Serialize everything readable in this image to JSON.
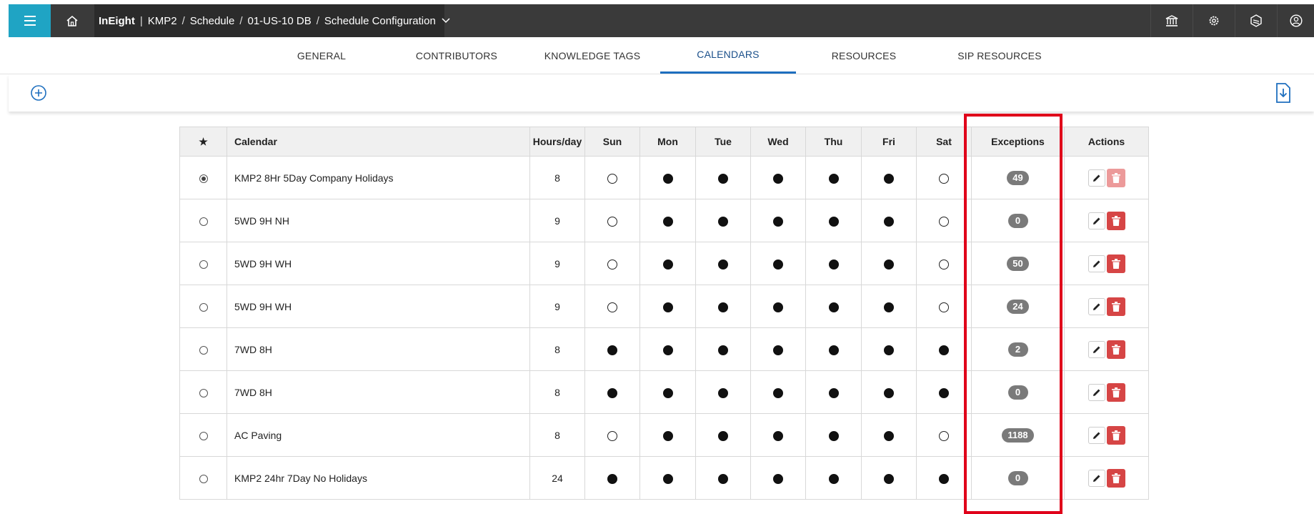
{
  "breadcrumb": {
    "brand": "InEight",
    "divider": "|",
    "items": [
      "KMP2",
      "Schedule",
      "01-US-10 DB",
      "Schedule Configuration"
    ],
    "separator": "/"
  },
  "tabs": [
    {
      "label": "GENERAL",
      "active": false
    },
    {
      "label": "CONTRIBUTORS",
      "active": false
    },
    {
      "label": "KNOWLEDGE TAGS",
      "active": false
    },
    {
      "label": "CALENDARS",
      "active": true
    },
    {
      "label": "RESOURCES",
      "active": false
    },
    {
      "label": "SIP RESOURCES",
      "active": false
    }
  ],
  "table": {
    "headers": {
      "default": "★",
      "calendar": "Calendar",
      "hours": "Hours/day",
      "days": [
        "Sun",
        "Mon",
        "Tue",
        "Wed",
        "Thu",
        "Fri",
        "Sat"
      ],
      "exceptions": "Exceptions",
      "actions": "Actions"
    },
    "rows": [
      {
        "default": true,
        "name": "KMP2 8Hr 5Day Company Holidays",
        "hours": "8",
        "days": [
          false,
          true,
          true,
          true,
          true,
          true,
          false
        ],
        "exceptions": "49",
        "delete_disabled": true
      },
      {
        "default": false,
        "name": "5WD 9H NH",
        "hours": "9",
        "days": [
          false,
          true,
          true,
          true,
          true,
          true,
          false
        ],
        "exceptions": "0",
        "delete_disabled": false
      },
      {
        "default": false,
        "name": "5WD 9H WH",
        "hours": "9",
        "days": [
          false,
          true,
          true,
          true,
          true,
          true,
          false
        ],
        "exceptions": "50",
        "delete_disabled": false
      },
      {
        "default": false,
        "name": "5WD 9H WH",
        "hours": "9",
        "days": [
          false,
          true,
          true,
          true,
          true,
          true,
          false
        ],
        "exceptions": "24",
        "delete_disabled": false
      },
      {
        "default": false,
        "name": "7WD 8H",
        "hours": "8",
        "days": [
          true,
          true,
          true,
          true,
          true,
          true,
          true
        ],
        "exceptions": "2",
        "delete_disabled": false
      },
      {
        "default": false,
        "name": "7WD 8H",
        "hours": "8",
        "days": [
          true,
          true,
          true,
          true,
          true,
          true,
          true
        ],
        "exceptions": "0",
        "delete_disabled": false
      },
      {
        "default": false,
        "name": "AC Paving",
        "hours": "8",
        "days": [
          false,
          true,
          true,
          true,
          true,
          true,
          false
        ],
        "exceptions": "1188",
        "delete_disabled": false
      },
      {
        "default": false,
        "name": "KMP2 24hr 7Day No Holidays",
        "hours": "24",
        "days": [
          true,
          true,
          true,
          true,
          true,
          true,
          true
        ],
        "exceptions": "0",
        "delete_disabled": false
      }
    ]
  },
  "colors": {
    "topbar": "#3a3a3a",
    "menu_accent": "#1fa4c4",
    "tab_active": "#1e6fbf",
    "badge": "#7a7a7a",
    "delete": "#d64545",
    "highlight": "#e0001a"
  },
  "icons": {
    "menu": "hamburger-icon",
    "home": "home-icon",
    "breadcrumb_dropdown": "chevron-down-icon",
    "top_right": [
      "bank-icon",
      "gear-icon",
      "cube-icon",
      "user-circle-icon"
    ],
    "add": "plus-circle-icon",
    "export": "file-export-icon",
    "edit": "pencil-icon",
    "delete": "trash-icon"
  }
}
